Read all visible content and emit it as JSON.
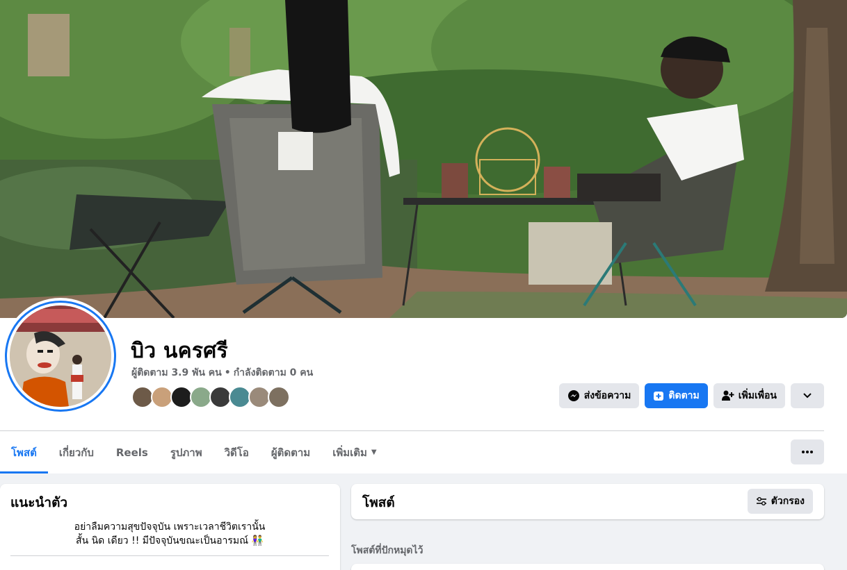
{
  "profile": {
    "name": "บิว นครศรี",
    "followers": "ผู้ติดตาม 3.9 พัน คน",
    "separator": "•",
    "following": "กำลังติดตาม 0 คน"
  },
  "actions": {
    "message_label": "ส่งข้อความ",
    "follow_label": "ติดตาม",
    "add_friend_label": "เพิ่มเพื่อน"
  },
  "tabs": [
    {
      "label": "โพสต์"
    },
    {
      "label": "เกี่ยวกับ"
    },
    {
      "label": "Reels"
    },
    {
      "label": "รูปภาพ"
    },
    {
      "label": "วิดีโอ"
    },
    {
      "label": "ผู้ติดตาม"
    },
    {
      "label": "เพิ่มเติม"
    }
  ],
  "intro": {
    "title": "แนะนำตัว",
    "bio_line1": "อย่าลืมความสุขปัจจุบัน เพราะเวลาชีวิตเรานั้น",
    "bio_line2": "สั้น นิด เดียว !! มีปัจจุบันขณะเป็นอารมณ์ 👫"
  },
  "posts": {
    "title": "โพสต์",
    "filter_label": "ตัวกรอง",
    "pinned_label": "โพสต์ที่ปักหมุดไว้"
  },
  "colors": {
    "accent": "#1877f2",
    "secondary_button": "#e4e6eb",
    "muted_text": "#65676b",
    "page_bg": "#f0f2f5"
  }
}
